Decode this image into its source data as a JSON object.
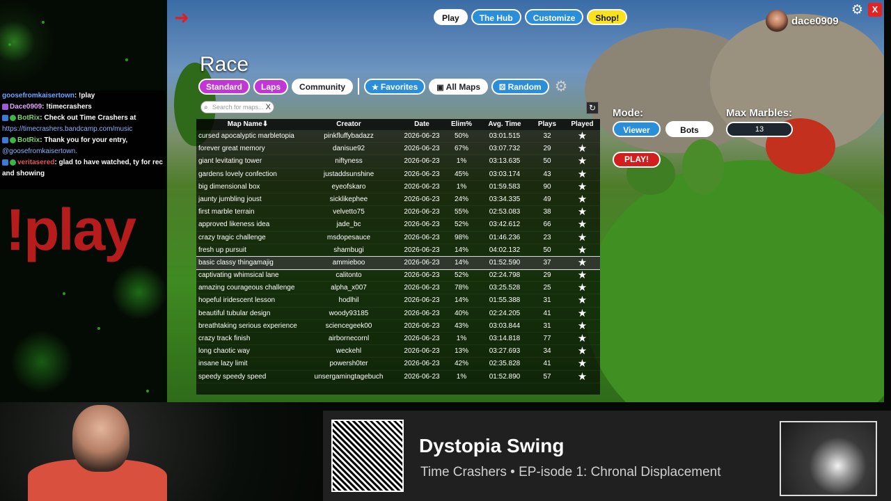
{
  "chat": {
    "messages": [
      {
        "user": "goosefromkaisertown",
        "text": ": !play",
        "badge": "none",
        "color": "u"
      },
      {
        "user": "Dace0909",
        "text": ": !timecrashers",
        "badge": "p",
        "color": "d"
      },
      {
        "user": "BotRix",
        "text": ": Check out Time Crashers at",
        "badge": "g",
        "color": "b",
        "link": "https://timecrashers.bandcamp.com/music"
      },
      {
        "user": "BotRix",
        "text": ": Thank you for your entry,",
        "badge": "g",
        "color": "b",
        "link": "@goosefromkaisertown."
      },
      {
        "user": "veritasered",
        "text": ": glad to have watched, ty for rec and showing",
        "badge": "g",
        "color": "v"
      }
    ]
  },
  "overlay_command": "!play",
  "top_nav": {
    "play": "Play",
    "hub": "The Hub",
    "customize": "Customize",
    "shop": "Shop!"
  },
  "user": {
    "name": "dace0909"
  },
  "close_label": "X",
  "race": {
    "title": "Race",
    "tabs": {
      "standard": "Standard",
      "laps": "Laps",
      "community": "Community",
      "favorites": "Favorites",
      "all_maps": "All Maps",
      "random": "Random"
    },
    "search_placeholder": "Search for maps...",
    "search_clear": "X"
  },
  "table": {
    "headers": {
      "map": "Map Name",
      "creator": "Creator",
      "date": "Date",
      "elim": "Elim%",
      "avg": "Avg. Time",
      "plays": "Plays",
      "played": "Played"
    },
    "rows": [
      {
        "map": "cursed apocalyptic marbletopia",
        "creator": "pinkfluffybadazz",
        "date": "2026-06-23",
        "elim": "50%",
        "avg": "03:01.515",
        "plays": "32"
      },
      {
        "map": "forever great memory",
        "creator": "danisue92",
        "date": "2026-06-23",
        "elim": "67%",
        "avg": "03:07.732",
        "plays": "29"
      },
      {
        "map": "giant levitating tower",
        "creator": "niftyness",
        "date": "2026-06-23",
        "elim": "1%",
        "avg": "03:13.635",
        "plays": "50"
      },
      {
        "map": "gardens lovely confection",
        "creator": "justaddsunshine",
        "date": "2026-06-23",
        "elim": "45%",
        "avg": "03:03.174",
        "plays": "43"
      },
      {
        "map": "big dimensional box",
        "creator": "eyeofskaro",
        "date": "2026-06-23",
        "elim": "1%",
        "avg": "01:59.583",
        "plays": "90"
      },
      {
        "map": "jaunty jumbling joust",
        "creator": "sicklikephee",
        "date": "2026-06-23",
        "elim": "24%",
        "avg": "03:34.335",
        "plays": "49"
      },
      {
        "map": "first marble terrain",
        "creator": "velvetto75",
        "date": "2026-06-23",
        "elim": "55%",
        "avg": "02:53.083",
        "plays": "38"
      },
      {
        "map": "approved likeness idea",
        "creator": "jade_bc",
        "date": "2026-06-23",
        "elim": "52%",
        "avg": "03:42.612",
        "plays": "66"
      },
      {
        "map": "crazy tragic challenge",
        "creator": "msdopesauce",
        "date": "2026-06-23",
        "elim": "98%",
        "avg": "01:46.236",
        "plays": "23"
      },
      {
        "map": "fresh up pursuit",
        "creator": "shambugi",
        "date": "2026-06-23",
        "elim": "14%",
        "avg": "04:02.132",
        "plays": "50"
      },
      {
        "map": "basic classy thingamajig",
        "creator": "ammieboo",
        "date": "2026-06-23",
        "elim": "14%",
        "avg": "01:52.590",
        "plays": "37"
      },
      {
        "map": "captivating whimsical lane",
        "creator": "calitonto",
        "date": "2026-06-23",
        "elim": "52%",
        "avg": "02:24.798",
        "plays": "29"
      },
      {
        "map": "amazing courageous challenge",
        "creator": "alpha_x007",
        "date": "2026-06-23",
        "elim": "78%",
        "avg": "03:25.528",
        "plays": "25"
      },
      {
        "map": "hopeful iridescent lesson",
        "creator": "hodlhil",
        "date": "2026-06-23",
        "elim": "14%",
        "avg": "01:55.388",
        "plays": "31"
      },
      {
        "map": "beautiful tubular design",
        "creator": "woody93185",
        "date": "2026-06-23",
        "elim": "40%",
        "avg": "02:24.205",
        "plays": "41"
      },
      {
        "map": "breathtaking serious experience",
        "creator": "sciencegeek00",
        "date": "2026-06-23",
        "elim": "43%",
        "avg": "03:03.844",
        "plays": "31"
      },
      {
        "map": "crazy track finish",
        "creator": "airbornecornl",
        "date": "2026-06-23",
        "elim": "1%",
        "avg": "03:14.818",
        "plays": "77"
      },
      {
        "map": "long chaotic way",
        "creator": "weckehl",
        "date": "2026-06-23",
        "elim": "13%",
        "avg": "03:27.693",
        "plays": "34"
      },
      {
        "map": "insane lazy limit",
        "creator": "powersh0ter",
        "date": "2026-06-23",
        "elim": "42%",
        "avg": "02:35.828",
        "plays": "41"
      },
      {
        "map": "speedy speedy speed",
        "creator": "unsergamingtagebuch",
        "date": "2026-06-23",
        "elim": "1%",
        "avg": "01:52.890",
        "plays": "57"
      }
    ],
    "selected_index": 10
  },
  "controls": {
    "mode_label": "Mode:",
    "viewer": "Viewer",
    "bots": "Bots",
    "max_marbles_label": "Max Marbles:",
    "max_marbles_value": "13",
    "play_button": "PLAY!"
  },
  "now_playing": {
    "title": "Dystopia Swing",
    "subtitle": "Time Crashers • EP-isode 1: Chronal Displacement"
  },
  "colors": {
    "accent_purple": "#c336d6",
    "accent_blue": "#2a8ed8",
    "shop_yellow": "#f7e21c",
    "play_red": "#d21e1e"
  }
}
